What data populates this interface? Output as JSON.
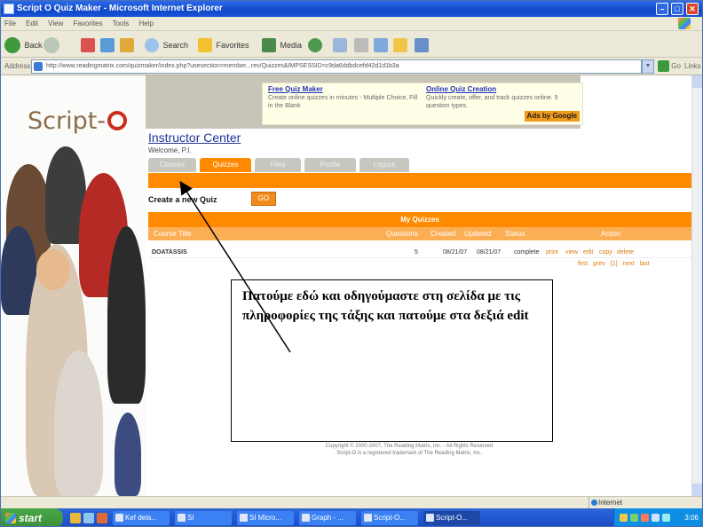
{
  "window": {
    "title": "Script O Quiz Maker - Microsoft Internet Explorer"
  },
  "menubar": {
    "items": [
      "File",
      "Edit",
      "View",
      "Favorites",
      "Tools",
      "Help"
    ]
  },
  "toolbar": {
    "back": "Back",
    "search": "Search",
    "favorites": "Favorites",
    "media": "Media"
  },
  "addressbar": {
    "label": "Address",
    "url": "http://www.readingmatrix.com/quizmaker/index.php?usesection=member...rev/Quizzes&IMPSESSID=c9da6ddbdcefd42d1d1b3a",
    "go": "Go",
    "links": "Links"
  },
  "sidebar": {
    "logo_text": "Script-"
  },
  "ads": {
    "ad1_title": "Free Quiz Maker",
    "ad1_text": "Create online quizzes in minutes - Multiple Choice, Fill in the Blank",
    "ad2_title": "Online Quiz Creation",
    "ad2_text": "Quickly create, offer, and track quizzes online. 5 question types.",
    "ads_by": "Ads by Google"
  },
  "instructor": {
    "title": "Instructor Center",
    "welcome": "Welcome, P.I."
  },
  "tabs": [
    "Classes",
    "Quizzes",
    "Files",
    "Profile",
    "Logout"
  ],
  "create_quiz": {
    "label": "Create a new Quiz",
    "go": "GO"
  },
  "my_quizzes": {
    "header": "My Quizzes",
    "columns": [
      "Course Title",
      "Questions",
      "Created",
      "Updated",
      "Status",
      "Action"
    ],
    "rows": [
      {
        "title": "DOATASSIS",
        "questions": "5",
        "created": "08/21/07",
        "updated": "08/21/07",
        "status": "complete",
        "actions": [
          "print",
          "view",
          "edit",
          "copy",
          "delete"
        ]
      }
    ],
    "pager": [
      "first",
      "prev",
      "[1]",
      "next",
      "last"
    ]
  },
  "footer": {
    "line1": "Copyright © 2000-2007, The Reading Matrix, Inc. - All Rights Reserved",
    "line2": "Script-O is a registered trademark of The Reading Matrix, Inc."
  },
  "callout": {
    "text": "Πατούμε εδώ και οδηγούμαστε στη σελίδα με τις πληροφορίες της τάξης και πατούμε στα δεξιά edit"
  },
  "statusbar": {
    "zone": "Internet"
  },
  "taskbar": {
    "start": "start",
    "tasks": [
      "Kef dela...",
      "SI",
      "SI Micro...",
      "Graph - ...",
      "Script-O...",
      "Script-O..."
    ],
    "clock": "3:06 "
  },
  "colors": {
    "accent_orange": "#ff8a00",
    "link_blue": "#223399"
  }
}
